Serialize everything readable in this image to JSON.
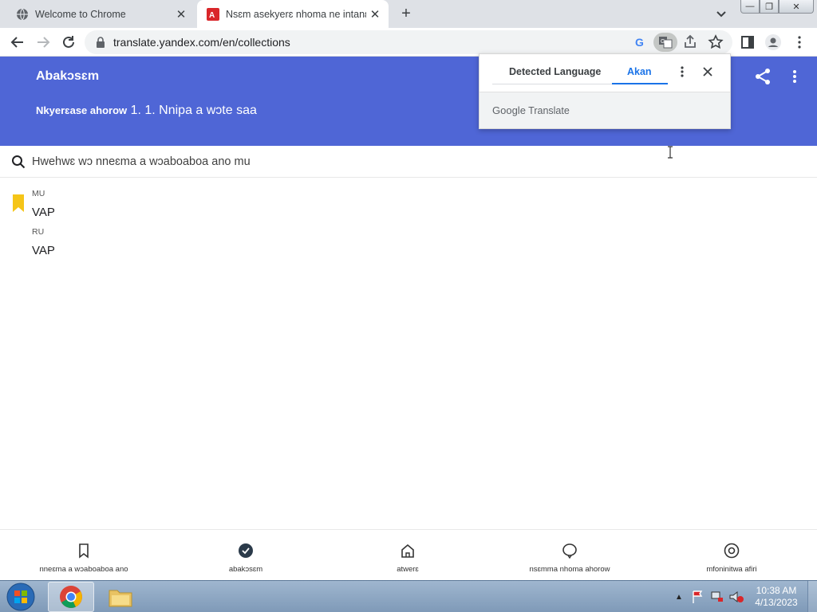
{
  "browser": {
    "tabs": [
      {
        "title": "Welcome to Chrome",
        "favicon": "chrome-icon",
        "active": false
      },
      {
        "title": "Nsɛm asekyerɛ nhoma ne intanɛt",
        "favicon": "yandex-translate-icon",
        "active": true
      }
    ],
    "url": "translate.yandex.com/en/collections"
  },
  "header": {
    "title": "Abakɔsɛm",
    "subtitle_prefix": "Nkyerɛase ahorow",
    "subtitle_main": "1. 1. Nnipa a wɔte saa"
  },
  "translate_popup": {
    "tab_detected": "Detected Language",
    "tab_akan": "Akan",
    "footer_brand": "Google",
    "footer_product": "Translate"
  },
  "search": {
    "placeholder": "Hwehwɛ wɔ nneɛma a wɔaboaboa ano mu"
  },
  "collection": {
    "items": [
      {
        "lang": "MU",
        "word": "VAP"
      },
      {
        "lang": "RU",
        "word": "VAP"
      }
    ]
  },
  "bottom_nav": [
    {
      "label": "nneɛma a wɔaboaboa ano",
      "icon": "bookmark-icon"
    },
    {
      "label": "abakɔsɛm",
      "icon": "check-circle-icon"
    },
    {
      "label": "atwerɛ",
      "icon": "home-icon"
    },
    {
      "label": "nsɛmma nhoma ahorow",
      "icon": "chat-bubble-icon"
    },
    {
      "label": "mfoninitwa afiri",
      "icon": "camera-icon"
    }
  ],
  "taskbar": {
    "time": "10:38 AM",
    "date": "4/13/2023"
  },
  "colors": {
    "yandex_header": "#4f66d6",
    "google_blue": "#1a73e8",
    "bookmark_yellow": "#f5c518"
  }
}
